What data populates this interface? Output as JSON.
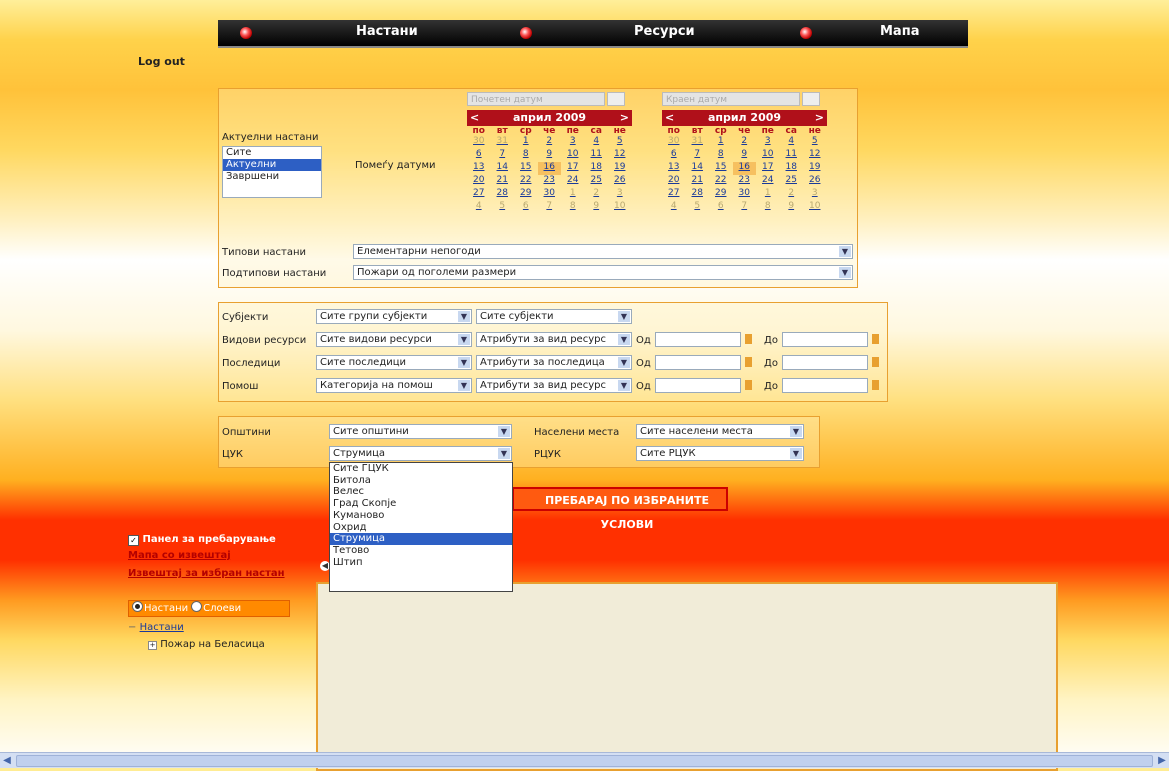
{
  "nav": {
    "items": [
      "Настани",
      "Ресурси",
      "Мапа"
    ]
  },
  "logout": "Log out",
  "filters": {
    "active_label": "Актуелни настани",
    "active_options": [
      "Сите",
      "Актуелни",
      "Завршени"
    ],
    "active_selected": "Актуелни",
    "between_dates_label": "Помеѓу датуми",
    "types_label": "Типови настани",
    "types_value": "Елементарни непогоди",
    "subtypes_label": "Подтипови настани",
    "subtypes_value": "Пожари од поголеми размери"
  },
  "calendars": [
    {
      "date_placeholder": "Почетен датум",
      "month": "април 2009",
      "prev": "<",
      "next": ">"
    },
    {
      "date_placeholder": "Краен датум",
      "month": "април 2009",
      "prev": "<",
      "next": ">"
    }
  ],
  "calendar_days": [
    "по",
    "вт",
    "ср",
    "че",
    "пе",
    "са",
    "не"
  ],
  "calendar_rows": [
    [
      "30",
      "31",
      "1",
      "2",
      "3",
      "4",
      "5"
    ],
    [
      "6",
      "7",
      "8",
      "9",
      "10",
      "11",
      "12"
    ],
    [
      "13",
      "14",
      "15",
      "16",
      "17",
      "18",
      "19"
    ],
    [
      "20",
      "21",
      "22",
      "23",
      "24",
      "25",
      "26"
    ],
    [
      "27",
      "28",
      "29",
      "30",
      "1",
      "2",
      "3"
    ],
    [
      "4",
      "5",
      "6",
      "7",
      "8",
      "9",
      "10"
    ]
  ],
  "resources": {
    "rows": [
      {
        "label": "Субјекти",
        "sel1": "Сите групи субјекти",
        "sel2": "Сите субјекти"
      },
      {
        "label": "Видови ресурси",
        "sel1": "Сите видови ресурси",
        "sel2": "Атрибути за вид ресурс",
        "from": "Од",
        "to": "До"
      },
      {
        "label": "Последици",
        "sel1": "Сите последици",
        "sel2": "Атрибути за последица",
        "from": "Од",
        "to": "До"
      },
      {
        "label": "Помош",
        "sel1": "Категорија на помош",
        "sel2": "Атрибути за вид ресурс",
        "from": "Од",
        "to": "До"
      }
    ]
  },
  "location": {
    "municipalities_label": "Општини",
    "municipalities_value": "Сите општини",
    "settlements_label": "Населени места",
    "settlements_value": "Сите населени места",
    "cuk_label": "ЦУК",
    "cuk_value": "Струмица",
    "rcuk_label": "РЦУК",
    "rcuk_value": "Сите РЦУК"
  },
  "dropdown": {
    "options": [
      "Сите ГЦУК",
      "Битола",
      "Велес",
      "Град Скопје",
      "Куманово",
      "Охрид",
      "Струмица",
      "Тетово",
      "Штип"
    ],
    "selected": "Струмица"
  },
  "search_button": "ПРЕБАРАЈ ПО ИЗБРАНИТЕ УСЛОВИ",
  "side": {
    "panel_label": "Панел за пребарување",
    "map_link": "Мапа со извештај",
    "report_link": "Извештај за избран настан",
    "radio_events": "Настани",
    "radio_layers": "Слоеви",
    "tree_root": "Настани",
    "tree_child": "Пожар на Беласица"
  }
}
